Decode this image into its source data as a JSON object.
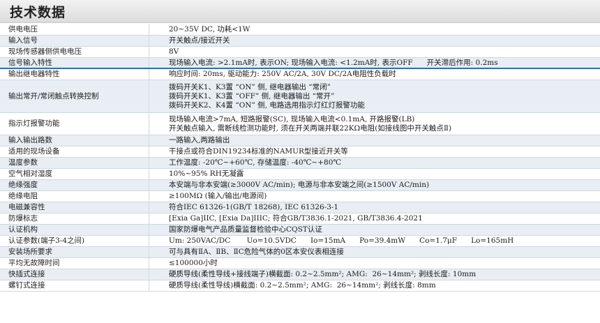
{
  "title": "技术数据",
  "rows": [
    {
      "label": "供电电压",
      "lines": [
        "20~35V DC, 功耗<1W"
      ]
    },
    {
      "label": "输入信号",
      "lines": [
        "开关触点/接近开关"
      ]
    },
    {
      "label": "现场传感器侧供电电压",
      "lines": [
        "8V"
      ]
    },
    {
      "label": "信号输入特性",
      "lines": [
        "现场输入电流: >2.1mA时, 表示ON; 现场输入电流: <1.2mA时, 表示OFF      开关滞后作用: 0.2ms"
      ]
    },
    {
      "label": "输出继电器特性",
      "lines": [
        "响应时间: 20ms, 驱动能力: 250V AC/2A, 30V DC/2A电阻性负载时"
      ]
    },
    {
      "label": "输出常开/常闭触点转换控制",
      "lines": [
        "拨码开关K1、K3置 “ON” 侧, 继电器输出 “常闭”",
        "拨码开关K1、K3置 “OFF” 侧, 继电器输出 “常开”",
        "拨码开关K2、K4置 “ON” 侧, 电路选用指示灯红灯报警功能"
      ]
    },
    {
      "label": "指示灯报警功能",
      "lines": [
        "现场输入电流>7mA, 短路报警(SC), 现场输入电流<0.1mA, 开路报警(LB)",
        "开关触点输入, 需断线检测功能时, 须在开关两端并联22KΩ电阻(如接线图中开关触点Ⅱ)"
      ]
    },
    {
      "label": "输入输出路数",
      "lines": [
        "一路输入,两路输出"
      ]
    },
    {
      "label": "适用的现场设备",
      "lines": [
        "干接点或符合DIN19234标准的NAMUR型接近开关等"
      ]
    },
    {
      "label": "温度参数",
      "lines": [
        "工作温度: -20℃~+60℃, 存储温度: -40℃~+80℃"
      ]
    },
    {
      "label": "空气相对湿度",
      "lines": [
        "10%~95% RH无凝露"
      ]
    },
    {
      "label": "绝缘强度",
      "lines": [
        "本安端与非本安端(≥3000V AC/min); 电源与非本安端之间(≥1500V AC/min)"
      ]
    },
    {
      "label": "绝缘电阻",
      "lines": [
        "≥100MΩ (输入/输出/电源间)"
      ]
    },
    {
      "label": "电磁兼容性",
      "lines": [
        "符合IEC 61326-1(GB/T 18268), IEC 61326-3-1"
      ]
    },
    {
      "label": "防爆标志",
      "lines": [
        "[Exia Ga]IIC, [Exia Da]IIIC; 符合GB/T3836.1-2021, GB/T3836.4-2021"
      ]
    },
    {
      "label": "认证机构",
      "lines": [
        "国家防爆电气产品质量监督检验中心CQST认证"
      ]
    },
    {
      "label": "认证参数(端子3-4之间)",
      "lines": [
        "Um: 250VAC/DC       Uo=10.5VDC      Io=15mA      Po=39.4mW      Co=1.7μF      Lo=165mH"
      ]
    },
    {
      "label": "安装场所要求",
      "lines": [
        "可与具有ⅡA、ⅡB、ⅡC危险气体的0区本安仪表相连接"
      ]
    },
    {
      "label": "平均无故障时间",
      "lines": [
        "≤100000小时"
      ]
    },
    {
      "label": "快插式连接",
      "lines": [
        "硬质导线(柔性导线+接线端子)横截面: 0.2~2.5mm²; AMG:  26~14mm²; 剥线长度: 10mm"
      ]
    },
    {
      "label": "螺钉式连接",
      "lines": [
        "硬质导线(柔性导线)横截面: 0.2~2.5mm²; AMG:  26~14mm²; 剥线长度: 8mm"
      ]
    }
  ],
  "colors": {
    "accent": "#2f6fb3",
    "stripe": "#e8eef3",
    "border": "#cfd8df"
  }
}
